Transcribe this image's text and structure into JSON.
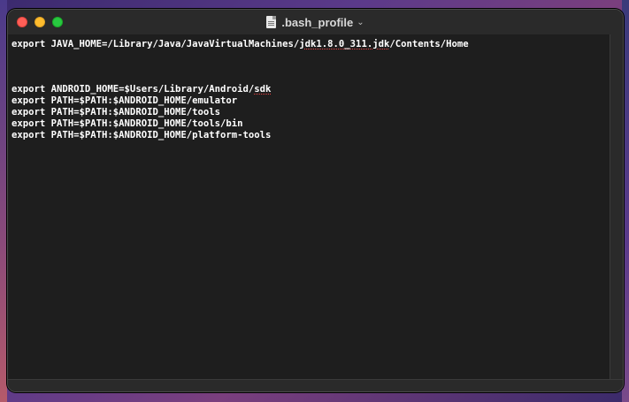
{
  "window": {
    "title": ".bash_profile",
    "chevron": "⌄",
    "colors": {
      "close": "#ff5f57",
      "minimize": "#febc2e",
      "maximize": "#28c840",
      "background": "#1e1e1e",
      "text": "#ffffff"
    }
  },
  "editor": {
    "lines": [
      {
        "prefix": "export JAVA_HOME=/Library/Java/JavaVirtualMachines/",
        "misspelled": "jdk1.8.0_311.jdk",
        "suffix": "/Contents/Home"
      },
      {
        "text": ""
      },
      {
        "text": ""
      },
      {
        "text": ""
      },
      {
        "prefix": "export ANDROID_HOME=$Users/Library/Android/",
        "misspelled": "sdk",
        "suffix": ""
      },
      {
        "text": "export PATH=$PATH:$ANDROID_HOME/emulator"
      },
      {
        "text": "export PATH=$PATH:$ANDROID_HOME/tools"
      },
      {
        "text": "export PATH=$PATH:$ANDROID_HOME/tools/bin"
      },
      {
        "text": "export PATH=$PATH:$ANDROID_HOME/platform-tools"
      }
    ]
  }
}
